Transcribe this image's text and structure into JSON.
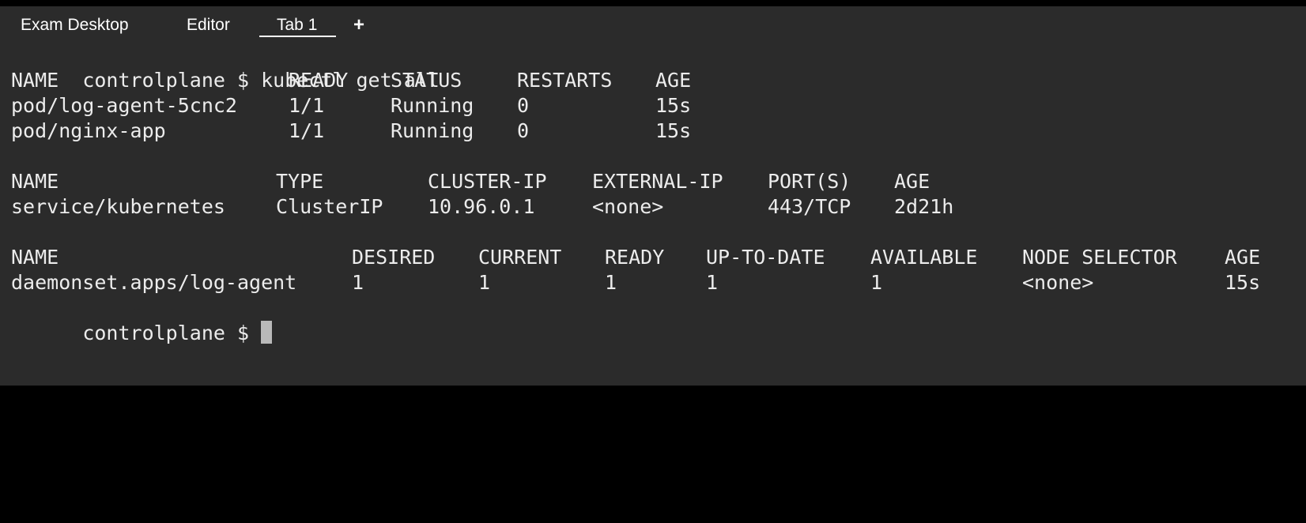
{
  "tabs": {
    "items": [
      "Exam Desktop",
      "Editor",
      "Tab 1"
    ],
    "active": "Tab 1",
    "new_tab": "+"
  },
  "terminal": {
    "command_line": {
      "prompt": "controlplane $",
      "command": "kubectl get all"
    },
    "pods": {
      "headers": [
        "NAME",
        "READY",
        "STATUS",
        "RESTARTS",
        "AGE"
      ],
      "rows": [
        [
          "pod/log-agent-5cnc2",
          "1/1",
          "Running",
          "0",
          "15s"
        ],
        [
          "pod/nginx-app",
          "1/1",
          "Running",
          "0",
          "15s"
        ]
      ]
    },
    "services": {
      "headers": [
        "NAME",
        "TYPE",
        "CLUSTER-IP",
        "EXTERNAL-IP",
        "PORT(S)",
        "AGE"
      ],
      "rows": [
        [
          "service/kubernetes",
          "ClusterIP",
          "10.96.0.1",
          "<none>",
          "443/TCP",
          "2d21h"
        ]
      ]
    },
    "daemonsets": {
      "headers": [
        "NAME",
        "DESIRED",
        "CURRENT",
        "READY",
        "UP-TO-DATE",
        "AVAILABLE",
        "NODE SELECTOR",
        "AGE"
      ],
      "rows": [
        [
          "daemonset.apps/log-agent",
          "1",
          "1",
          "1",
          "1",
          "1",
          "<none>",
          "15s"
        ]
      ]
    },
    "final_prompt": "controlplane $"
  }
}
